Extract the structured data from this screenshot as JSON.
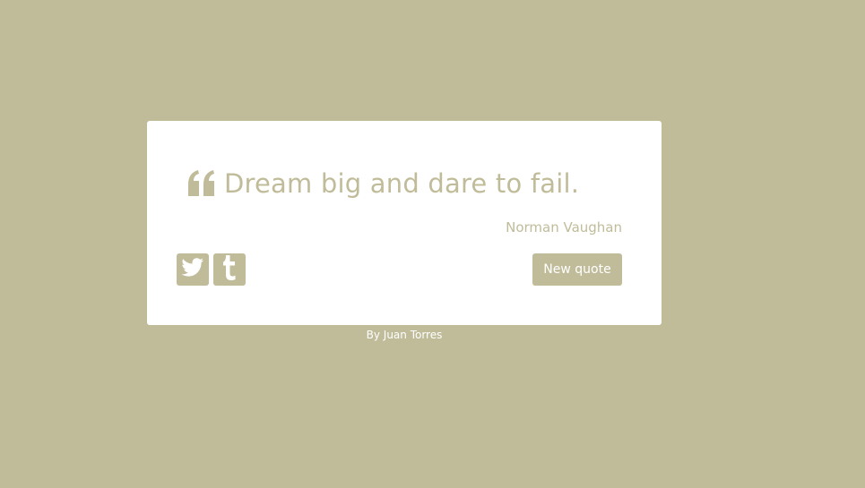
{
  "colors": {
    "background": "#c0bc9a",
    "card": "#ffffff",
    "accent": "#c0bc9a",
    "button_text": "#ffffff"
  },
  "quote": {
    "icon": "quote-left-icon",
    "text": "Dream big and dare to fail.",
    "author": "Norman Vaughan"
  },
  "social": [
    {
      "icon": "twitter-icon"
    },
    {
      "icon": "tumblr-icon"
    }
  ],
  "actions": {
    "new_quote_label": "New quote"
  },
  "footer": {
    "byline": "By Juan Torres"
  }
}
